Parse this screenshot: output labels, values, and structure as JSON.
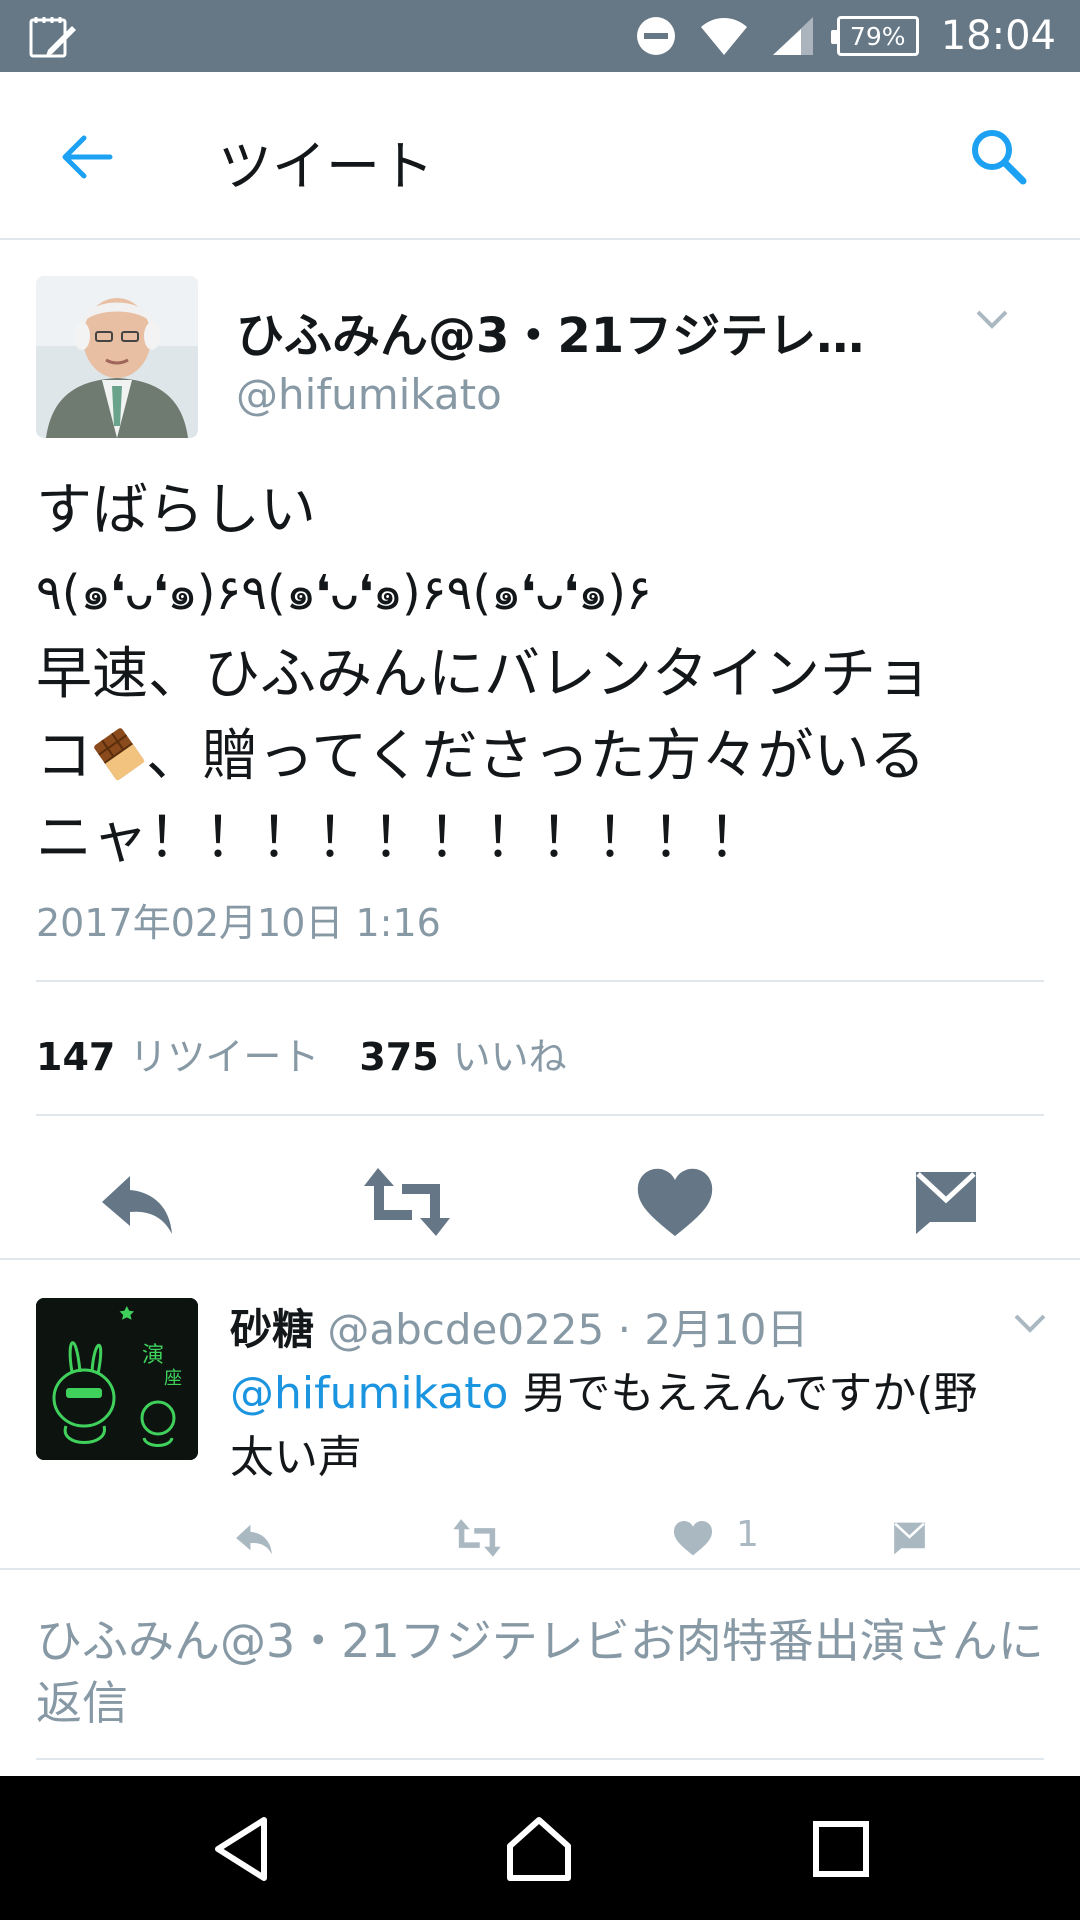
{
  "status_bar": {
    "battery": "79%",
    "time": "18:04"
  },
  "header": {
    "title": "ツイート"
  },
  "tweet": {
    "display_name": "ひふみん@3・21フジテレ…",
    "handle": "@hifumikato",
    "text_lines": [
      "すばらしい",
      "٩(๑❛ᴗ❛๑)۶٩(๑❛ᴗ❛๑)۶٩(๑❛ᴗ❛๑)۶",
      "早速、ひふみんにバレンタインチョ",
      "コ",
      "、贈ってくださった方々がいる",
      "ニャ！！！！！！！！！！！"
    ],
    "timestamp": "2017年02月10日 1:16",
    "retweet_count": "147",
    "retweet_label": "リツイート",
    "like_count": "375",
    "like_label": "いいね"
  },
  "reply": {
    "name": "砂糖",
    "handle": "@abcde0225",
    "separator": " · ",
    "date": "2月10日",
    "mention": "@hifumikato",
    "text": " 男でもええんですか(野太い声",
    "like_count": "1"
  },
  "reply_prompt": "ひふみん@3・21フジテレビお肉特番出演さんに返信",
  "colors": {
    "status_bar": "#667786",
    "accent": "#1da1f2",
    "icon_gray": "#657786",
    "muted_text": "#8899a6",
    "divider": "#e1e8ed"
  },
  "icons": [
    "edit-note-icon",
    "dnd-icon",
    "wifi-icon",
    "signal-icon",
    "battery-icon",
    "back-arrow-icon",
    "search-icon",
    "chevron-down-icon",
    "reply-icon",
    "retweet-icon",
    "heart-icon",
    "dm-icon",
    "chocolate-emoji",
    "nav-back-icon",
    "nav-home-icon",
    "nav-recents-icon"
  ]
}
